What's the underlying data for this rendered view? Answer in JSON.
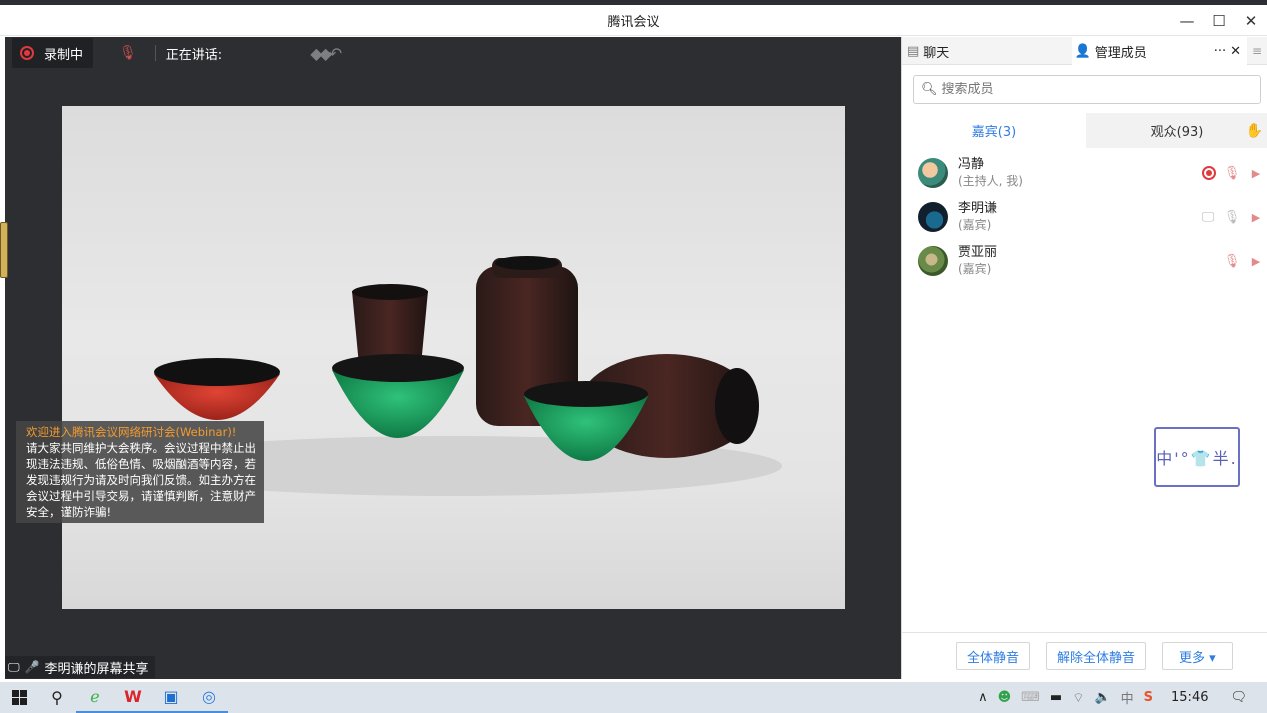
{
  "window": {
    "title": "腾讯会议",
    "minimize": "—",
    "maximize": "☐",
    "close": "✕"
  },
  "video": {
    "recording_label": "录制中",
    "speaking_label": "正在讲话:",
    "notice": {
      "headline": "欢迎进入腾讯会议网络研讨会(Webinar)!",
      "body": "请大家共同维护大会秩序。会议过程中禁止出现违法违规、低俗色情、吸烟酗酒等内容，若发现违规行为请及时向我们反馈。如主办方在会议过程中引导交易，请谨慎判断，注意财产安全，谨防诈骗!"
    },
    "share_label": "李明谦的屏幕共享"
  },
  "panel": {
    "tabs": [
      {
        "label": "聊天",
        "icon": "chat-icon"
      },
      {
        "label": "管理成员",
        "icon": "person-icon"
      }
    ],
    "tab_more": "···",
    "tab_close": "✕",
    "menu": "≡",
    "search_placeholder": "搜索成员",
    "member_tabs": {
      "guests": "嘉宾(3)",
      "audience": "观众(93)"
    },
    "members": [
      {
        "name": "冯静",
        "role": "(主持人, 我)"
      },
      {
        "name": "李明谦",
        "role": "(嘉宾)"
      },
      {
        "name": "贾亚丽",
        "role": "(嘉宾)"
      }
    ],
    "stamp_text": "中'°👕半.",
    "footer": {
      "mute_all": "全体静音",
      "unmute_all": "解除全体静音",
      "more": "更多 ▾"
    }
  },
  "taskbar": {
    "time": "15:46",
    "ime": "中"
  },
  "colors": {
    "accent": "#2f7de1",
    "recording": "#e0393e",
    "notice_highlight": "#f39b2f"
  }
}
